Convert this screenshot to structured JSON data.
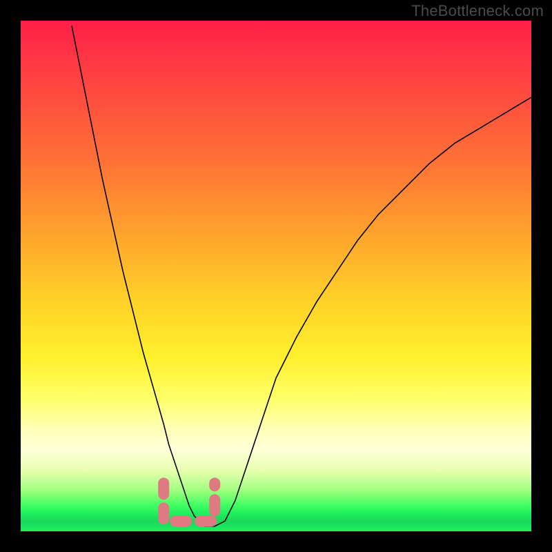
{
  "watermark": {
    "text": "TheBottleneck.com"
  },
  "chart_data": {
    "type": "line",
    "title": "",
    "xlabel": "",
    "ylabel": "",
    "xlim": [
      0,
      100
    ],
    "ylim": [
      0,
      100
    ],
    "grid": false,
    "legend": false,
    "series": [
      {
        "name": "bottleneck_curve",
        "x": [
          10,
          12,
          14,
          16,
          18,
          20,
          22,
          24,
          26,
          28,
          29,
          30,
          31,
          32,
          33,
          34,
          35,
          36,
          38,
          40,
          42,
          44,
          46,
          48,
          50,
          54,
          58,
          62,
          66,
          70,
          75,
          80,
          85,
          90,
          95,
          100
        ],
        "values": [
          99,
          89,
          79,
          69,
          60,
          51,
          43,
          35,
          28,
          21,
          17,
          14,
          11,
          8,
          5,
          3,
          2,
          1,
          1,
          2,
          6,
          12,
          18,
          24,
          30,
          38,
          45,
          51,
          57,
          62,
          67,
          72,
          76,
          79,
          82,
          85
        ]
      }
    ],
    "optimal_region_dashed": {
      "x_start": 28,
      "x_end": 38,
      "y_level": 2
    },
    "background_gradient": {
      "top": "#ff1d47",
      "mid": "#fff02c",
      "bottom": "#1fef5e"
    }
  }
}
